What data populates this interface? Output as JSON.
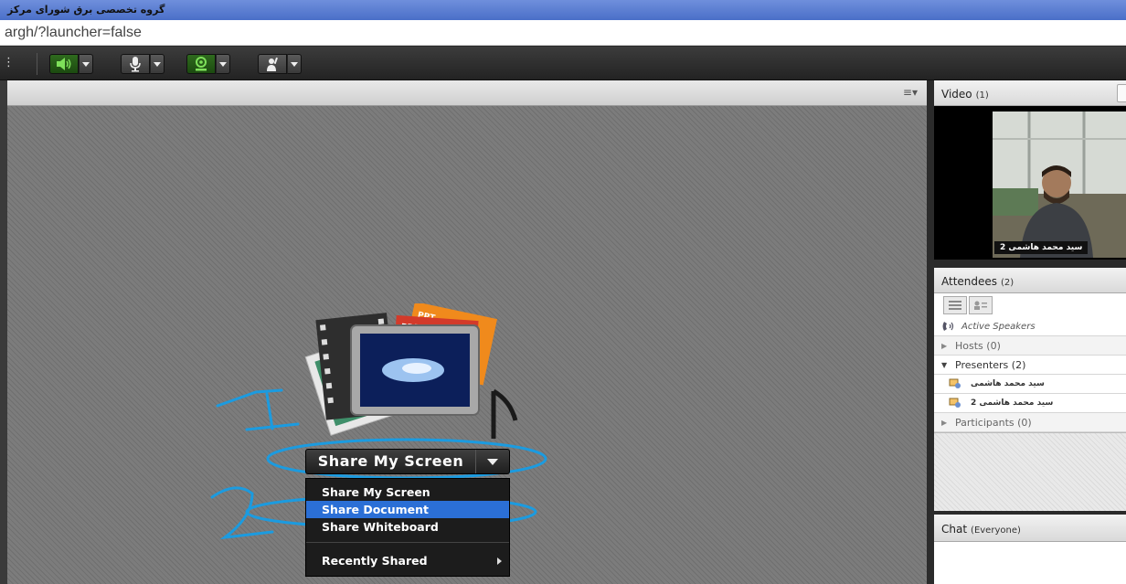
{
  "window": {
    "title": "گروه تخصصی برق شورای مرکز",
    "url": "argh/?launcher=false"
  },
  "toolbar": {
    "grip": "⋮",
    "buttons": [
      {
        "name": "speaker",
        "state": "on"
      },
      {
        "name": "microphone",
        "state": "off"
      },
      {
        "name": "webcam",
        "state": "on"
      },
      {
        "name": "raise-hand",
        "state": "off"
      }
    ],
    "accent_on": "#2f6b1e"
  },
  "share_pod": {
    "menu_icon": "≡▾",
    "share_button_label": "Share My Screen",
    "menu_items": [
      {
        "label": "Share My Screen"
      },
      {
        "label": "Share Document",
        "highlighted": true
      },
      {
        "label": "Share Whiteboard"
      }
    ],
    "recently_shared": "Recently Shared",
    "icon_badges": {
      "ppt": "PPT",
      "pdf": "PDF"
    },
    "annotations": [
      "1",
      "2"
    ],
    "highlight_color": "#2b6fd6",
    "annotation_color": "#1b9be0"
  },
  "video_pod": {
    "title": "Video",
    "count": "(1)",
    "name_tag": "سید محمد هاشمی 2"
  },
  "attendees_pod": {
    "title": "Attendees",
    "count": "(2)",
    "active_speakers": "Active Speakers",
    "groups": {
      "hosts": "Hosts (0)",
      "presenters": "Presenters (2)",
      "participants": "Participants (0)"
    },
    "presenters": [
      "سید محمد هاشمی",
      "سید محمد هاشمی 2"
    ]
  },
  "chat_pod": {
    "title": "Chat",
    "scope": "(Everyone)"
  }
}
